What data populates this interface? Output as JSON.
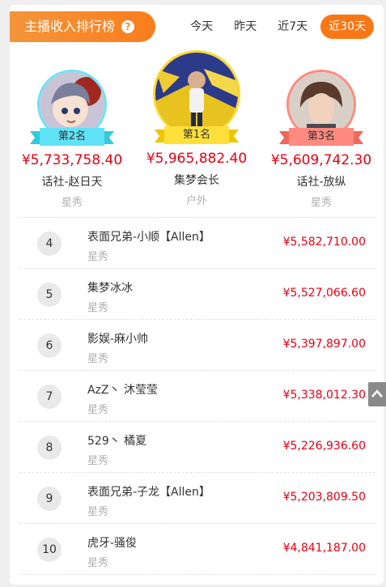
{
  "header": {
    "title": "主播收入排行榜",
    "help_glyph": "?",
    "tabs": [
      {
        "label": "今天",
        "active": false
      },
      {
        "label": "昨天",
        "active": false
      },
      {
        "label": "近7天",
        "active": false
      },
      {
        "label": "近30天",
        "active": true
      }
    ]
  },
  "top3": {
    "second": {
      "badge": "第2名",
      "amount": "¥5,733,758.40",
      "name": "话社-赵日天",
      "category": "星秀"
    },
    "first": {
      "badge": "第1名",
      "amount": "¥5,965,882.40",
      "name": "集梦会长",
      "category": "户外"
    },
    "third": {
      "badge": "第3名",
      "amount": "¥5,609,742.30",
      "name": "话社-放纵",
      "category": "星秀"
    }
  },
  "ranking": [
    {
      "rank": "4",
      "name": "表面兄弟-小顺【Allen】",
      "category": "星秀",
      "amount": "¥5,582,710.00"
    },
    {
      "rank": "5",
      "name": "集梦冰冰",
      "category": "星秀",
      "amount": "¥5,527,066.60"
    },
    {
      "rank": "6",
      "name": "影娱-麻小帅",
      "category": "星秀",
      "amount": "¥5,397,897.00"
    },
    {
      "rank": "7",
      "name": "AzZ丶 沐莹莹",
      "category": "星秀",
      "amount": "¥5,338,012.30"
    },
    {
      "rank": "8",
      "name": "529丶 橘夏",
      "category": "星秀",
      "amount": "¥5,226,936.60"
    },
    {
      "rank": "9",
      "name": "表面兄弟-子龙【Allen】",
      "category": "星秀",
      "amount": "¥5,203,809.50"
    },
    {
      "rank": "10",
      "name": "虎牙-骚俊",
      "category": "星秀",
      "amount": "¥4,841,187.00"
    }
  ],
  "colors": {
    "accent": "#fa7716",
    "money": "#e60012",
    "first_ribbon": "#ffd92e",
    "second_ribbon": "#5fe2f5",
    "third_ribbon": "#ff8a80"
  },
  "icons": {
    "scroll_top": "arrow-up-icon"
  }
}
